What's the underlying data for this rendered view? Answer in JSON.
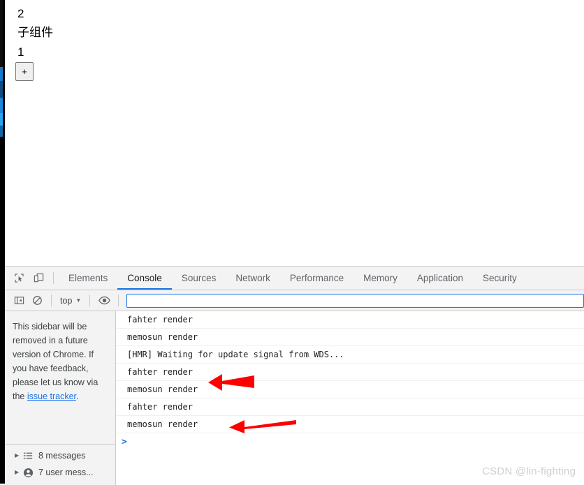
{
  "page": {
    "line1": "2",
    "line2": "子组件",
    "line3": "1",
    "plus_button": "+"
  },
  "devtools": {
    "tabbar": {
      "inspect_icon": "inspect-cursor-icon",
      "device_toolbar_icon": "device-toolbar-icon",
      "tabs": [
        {
          "label": "Elements",
          "active": false
        },
        {
          "label": "Console",
          "active": true
        },
        {
          "label": "Sources",
          "active": false
        },
        {
          "label": "Network",
          "active": false
        },
        {
          "label": "Performance",
          "active": false
        },
        {
          "label": "Memory",
          "active": false
        },
        {
          "label": "Application",
          "active": false
        },
        {
          "label": "Security",
          "active": false
        }
      ]
    },
    "console_toolbar": {
      "sidebar_toggle_icon": "sidebar-toggle-icon",
      "clear_console_icon": "clear-console-icon",
      "context_label": "top",
      "context_caret": "▼",
      "eye_icon": "eye-icon",
      "filter_value": "",
      "filter_placeholder": ""
    },
    "sidebar": {
      "notice_part1": "This sidebar will be removed in a future version of Chrome. If you have feedback, please let us know via the ",
      "notice_link": "issue tracker",
      "notice_part2": ".",
      "groups": [
        {
          "triangle": "▶",
          "icon": "list-icon",
          "label": "8 messages"
        },
        {
          "triangle": "▶",
          "icon": "person-icon",
          "label": "7 user mess..."
        }
      ]
    },
    "messages": [
      {
        "text": "fahter render"
      },
      {
        "text": "memosun render"
      },
      {
        "text": "[HMR] Waiting for update signal from WDS..."
      },
      {
        "text": "fahter render"
      },
      {
        "text": "memosun render"
      },
      {
        "text": "fahter render"
      },
      {
        "text": "memosun render"
      }
    ],
    "prompt_symbol": ">"
  },
  "annotations": {
    "arrow_color": "#ff0000",
    "arrows": [
      {
        "name": "arrow-pointing-to-memosun-render-row-5"
      },
      {
        "name": "arrow-pointing-to-memosun-render-row-7"
      }
    ]
  },
  "watermark": "CSDN @lin-fighting"
}
